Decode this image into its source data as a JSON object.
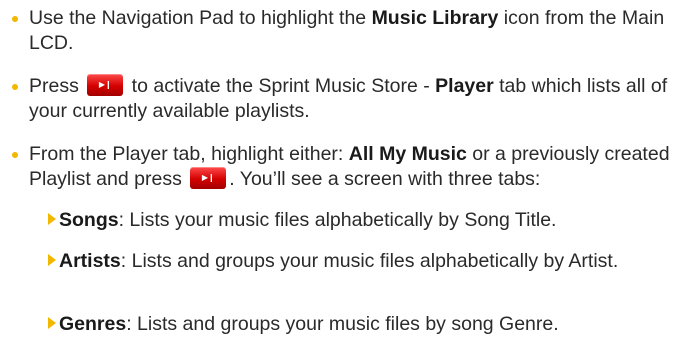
{
  "bullets": [
    {
      "p1": "Use the Navigation Pad to highlight the ",
      "b1": "Music Library",
      "p2": " icon from the Main LCD."
    },
    {
      "p1": "Press ",
      "p2": " to activate the Sprint Music Store - ",
      "b1": "Player",
      "p3": " tab which lists all of your currently available playlists."
    },
    {
      "p1": "From the Player tab, highlight either: ",
      "b1": "All My Music",
      "p2": " or a previously created Playlist and press ",
      "p3": ". You’ll see a screen with three tabs:"
    }
  ],
  "tabs": [
    {
      "name": "Songs",
      "desc": ": Lists your music files alphabetically by Song Title."
    },
    {
      "name": "Artists",
      "desc": ": Lists and groups your music files alphabetically by Artist."
    },
    {
      "name": "Genres",
      "desc": ": Lists and groups your music files by song Genre."
    }
  ],
  "colors": {
    "bullet": "#f2b800",
    "key": "#d40000",
    "text": "#2a2a2a"
  },
  "icons": {
    "play_pause_key": "play-pause-key-icon"
  }
}
